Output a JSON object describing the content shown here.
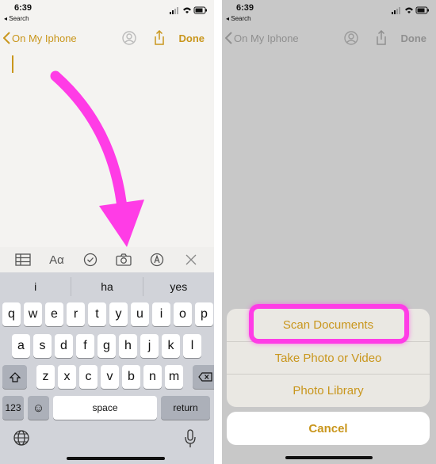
{
  "colors": {
    "accent": "#c9961c",
    "highlight": "#ff3ce6",
    "keyboard_bg": "#d1d3d9",
    "dimmed_overlay": "#c8c8c8"
  },
  "left": {
    "status": {
      "time": "6:39",
      "back_app": "◂ Search"
    },
    "nav": {
      "back_label": "On My Iphone",
      "done_label": "Done"
    },
    "toolbar": {
      "icons": [
        "table-icon",
        "text-format-icon",
        "checklist-icon",
        "camera-icon",
        "markup-icon",
        "close-icon"
      ],
      "format_label": "Aα"
    },
    "keyboard": {
      "suggestions": [
        "i",
        "ha",
        "yes"
      ],
      "row1": [
        "q",
        "w",
        "e",
        "r",
        "t",
        "y",
        "u",
        "i",
        "o",
        "p"
      ],
      "row2": [
        "a",
        "s",
        "d",
        "f",
        "g",
        "h",
        "j",
        "k",
        "l"
      ],
      "row3": [
        "z",
        "x",
        "c",
        "v",
        "b",
        "n",
        "m"
      ],
      "numbers_key": "123",
      "emoji_key": "☺",
      "space_key": "space",
      "return_key": "return"
    }
  },
  "right": {
    "status": {
      "time": "6:39",
      "back_app": "◂ Search"
    },
    "nav": {
      "back_label": "On My Iphone",
      "done_label": "Done"
    },
    "sheet": {
      "items": [
        "Scan Documents",
        "Take Photo or Video",
        "Photo Library"
      ],
      "cancel_label": "Cancel"
    }
  }
}
